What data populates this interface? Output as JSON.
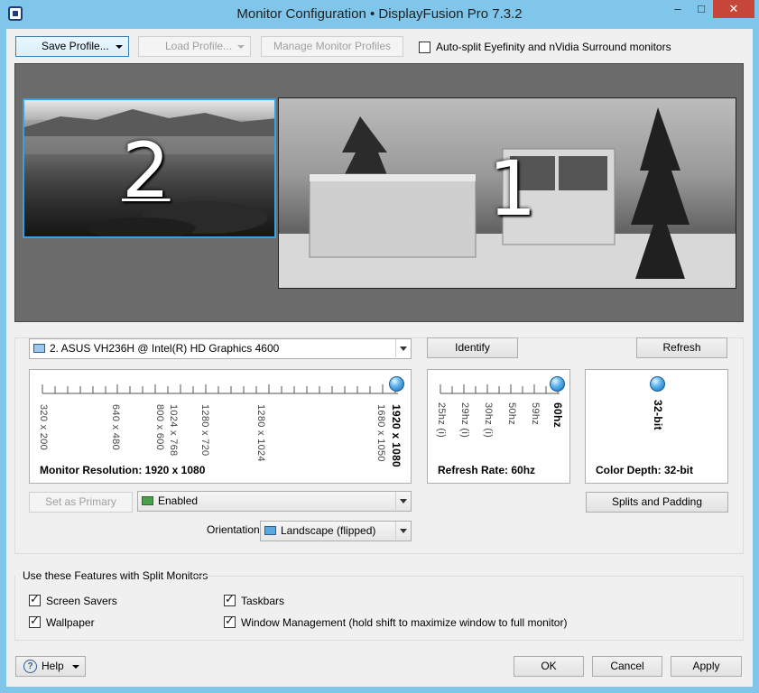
{
  "window": {
    "title": "Monitor Configuration • DisplayFusion Pro 7.3.2",
    "minimize": "–",
    "maximize": "□",
    "close": "✕"
  },
  "toolbar": {
    "save_profile": "Save Profile...",
    "load_profile": "Load Profile...",
    "manage_profiles": "Manage Monitor Profiles",
    "auto_split_label": "Auto-split Eyefinity and nVidia Surround monitors",
    "auto_split_checked": false
  },
  "layout": {
    "monitors": [
      {
        "number": "2",
        "selected": true
      },
      {
        "number": "1",
        "selected": false
      }
    ]
  },
  "monitor_settings": {
    "selected_monitor": "2. ASUS VH236H @ Intel(R) HD Graphics 4600",
    "identify": "Identify",
    "refresh": "Refresh",
    "resolution": {
      "ticks": [
        "320 x 200",
        "640 x 480",
        "800 x 600",
        "1024 x 768",
        "1280 x 720",
        "1280 x 1024",
        "1680 x 1050",
        "1920 x 1080"
      ],
      "selected": "1920 x 1080",
      "label": "Monitor Resolution: 1920 x 1080"
    },
    "refresh_rate": {
      "ticks": [
        "25hz (i)",
        "29hz (i)",
        "30hz (i)",
        "50hz",
        "59hz",
        "60hz"
      ],
      "selected": "60hz",
      "label": "Refresh Rate: 60hz"
    },
    "color_depth": {
      "ticks": [
        "32-bit"
      ],
      "selected": "32-bit",
      "label": "Color Depth: 32-bit"
    },
    "set_primary": "Set as Primary",
    "enabled_value": "Enabled",
    "splits_padding": "Splits and Padding",
    "orientation_label": "Orientation:",
    "orientation_value": "Landscape (flipped)"
  },
  "features": {
    "group_title": "Use these Features with Split Monitors",
    "items": [
      {
        "label": "Screen Savers",
        "checked": true
      },
      {
        "label": "Wallpaper",
        "checked": true
      },
      {
        "label": "Taskbars",
        "checked": true
      },
      {
        "label": "Window Management (hold shift to maximize window to full monitor)",
        "checked": true
      }
    ]
  },
  "footer": {
    "help": "Help",
    "ok": "OK",
    "cancel": "Cancel",
    "apply": "Apply"
  }
}
